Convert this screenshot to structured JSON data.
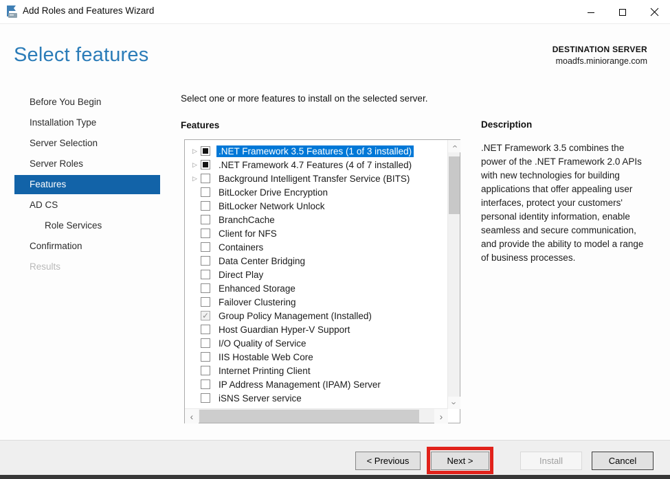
{
  "window": {
    "title": "Add Roles and Features Wizard",
    "controls": {
      "minimize": "minimize",
      "maximize": "maximize",
      "close": "close"
    }
  },
  "header": {
    "title": "Select features",
    "destination_label": "DESTINATION SERVER",
    "destination_server": "moadfs.miniorange.com"
  },
  "sidebar": {
    "items": [
      {
        "label": "Before You Begin",
        "state": "normal",
        "indent": false
      },
      {
        "label": "Installation Type",
        "state": "normal",
        "indent": false
      },
      {
        "label": "Server Selection",
        "state": "normal",
        "indent": false
      },
      {
        "label": "Server Roles",
        "state": "normal",
        "indent": false
      },
      {
        "label": "Features",
        "state": "selected",
        "indent": false
      },
      {
        "label": "AD CS",
        "state": "normal",
        "indent": false
      },
      {
        "label": "Role Services",
        "state": "normal",
        "indent": true
      },
      {
        "label": "Confirmation",
        "state": "normal",
        "indent": false
      },
      {
        "label": "Results",
        "state": "disabled",
        "indent": false
      }
    ]
  },
  "main": {
    "instruction": "Select one or more features to install on the selected server.",
    "features_label": "Features",
    "features": [
      {
        "label": ".NET Framework 3.5 Features (1 of 3 installed)",
        "checkbox": "indeterminate",
        "expandable": true,
        "selected": true
      },
      {
        "label": ".NET Framework 4.7 Features (4 of 7 installed)",
        "checkbox": "indeterminate",
        "expandable": true,
        "selected": false
      },
      {
        "label": "Background Intelligent Transfer Service (BITS)",
        "checkbox": "unchecked",
        "expandable": true,
        "selected": false
      },
      {
        "label": "BitLocker Drive Encryption",
        "checkbox": "unchecked",
        "expandable": false,
        "selected": false
      },
      {
        "label": "BitLocker Network Unlock",
        "checkbox": "unchecked",
        "expandable": false,
        "selected": false
      },
      {
        "label": "BranchCache",
        "checkbox": "unchecked",
        "expandable": false,
        "selected": false
      },
      {
        "label": "Client for NFS",
        "checkbox": "unchecked",
        "expandable": false,
        "selected": false
      },
      {
        "label": "Containers",
        "checkbox": "unchecked",
        "expandable": false,
        "selected": false
      },
      {
        "label": "Data Center Bridging",
        "checkbox": "unchecked",
        "expandable": false,
        "selected": false
      },
      {
        "label": "Direct Play",
        "checkbox": "unchecked",
        "expandable": false,
        "selected": false
      },
      {
        "label": "Enhanced Storage",
        "checkbox": "unchecked",
        "expandable": false,
        "selected": false
      },
      {
        "label": "Failover Clustering",
        "checkbox": "unchecked",
        "expandable": false,
        "selected": false
      },
      {
        "label": "Group Policy Management (Installed)",
        "checkbox": "checked_disabled",
        "expandable": false,
        "selected": false
      },
      {
        "label": "Host Guardian Hyper-V Support",
        "checkbox": "unchecked",
        "expandable": false,
        "selected": false
      },
      {
        "label": "I/O Quality of Service",
        "checkbox": "unchecked",
        "expandable": false,
        "selected": false
      },
      {
        "label": "IIS Hostable Web Core",
        "checkbox": "unchecked",
        "expandable": false,
        "selected": false
      },
      {
        "label": "Internet Printing Client",
        "checkbox": "unchecked",
        "expandable": false,
        "selected": false
      },
      {
        "label": "IP Address Management (IPAM) Server",
        "checkbox": "unchecked",
        "expandable": false,
        "selected": false
      },
      {
        "label": "iSNS Server service",
        "checkbox": "unchecked",
        "expandable": false,
        "selected": false
      }
    ]
  },
  "description": {
    "heading": "Description",
    "text": ".NET Framework 3.5 combines the power of the .NET Framework 2.0 APIs with new technologies for building applications that offer appealing user interfaces, protect your customers' personal identity information, enable seamless and secure communication, and provide the ability to model a range of business processes."
  },
  "footer": {
    "buttons": [
      {
        "label": "< Previous",
        "state": "enabled"
      },
      {
        "label": "Next >",
        "state": "enabled",
        "highlighted": true
      },
      {
        "label": "Install",
        "state": "disabled"
      },
      {
        "label": "Cancel",
        "state": "enabled"
      }
    ]
  },
  "colors": {
    "title_blue": "#2b7cb8",
    "sidebar_selected_blue": "#1263a8",
    "list_selection_blue": "#0078d7",
    "highlight_red": "#e1221b",
    "footer_gray": "#efefef"
  }
}
